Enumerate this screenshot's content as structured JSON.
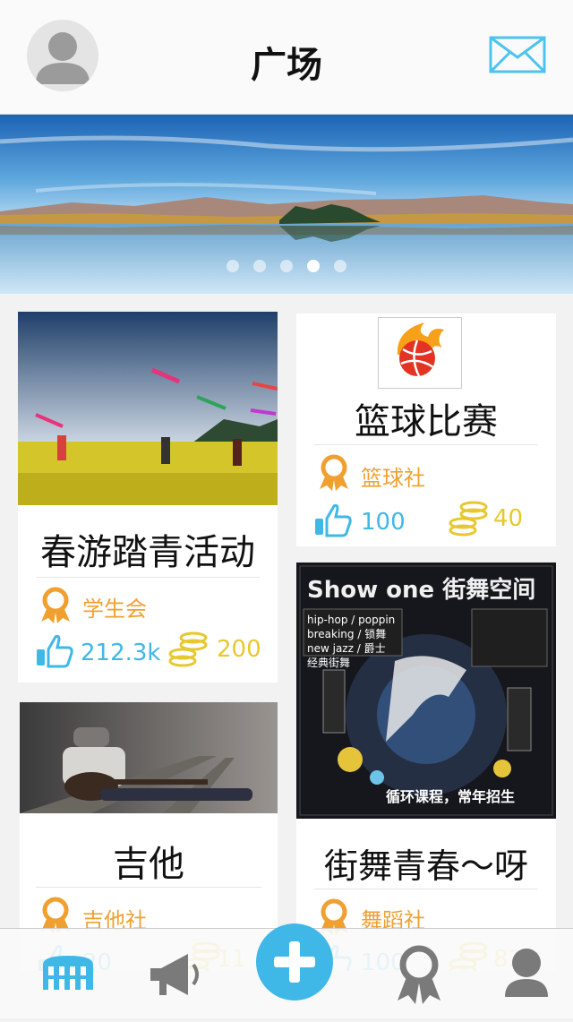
{
  "header": {
    "title": "广场",
    "avatar_icon": "user-avatar-icon",
    "mail_icon": "envelope-icon"
  },
  "banner": {
    "image": "lake-mountain-landscape",
    "slides": 5,
    "active_slide": 4
  },
  "cards": [
    {
      "title": "春游踏青活动",
      "org": "学生会",
      "likes": "212.3k",
      "coins": "200",
      "image": "kite-flying-flower-field"
    },
    {
      "title": "篮球比赛",
      "org": "篮球社",
      "likes": "100",
      "coins": "40",
      "image": "basketball-fire-logo"
    },
    {
      "title": "吉他",
      "org": "吉他社",
      "likes": "20",
      "coins": "11",
      "image": "guitarist-on-railway"
    },
    {
      "title": "街舞青春～呀",
      "org": "舞蹈社",
      "likes": "100",
      "coins": "83",
      "image": "street-dance-poster",
      "poster_text": {
        "headline": "Show one 街舞空间",
        "lines": [
          "hip-hop / poppin",
          "breaking / 锁舞",
          "new jazz / 爵士",
          "经典街舞"
        ],
        "footer": "循环课程，常年招生"
      }
    }
  ],
  "tabbar": {
    "items": [
      "colosseum-icon",
      "megaphone-icon",
      "add-icon",
      "award-icon",
      "profile-icon"
    ],
    "active": "colosseum-icon"
  },
  "colors": {
    "accent_blue": "#3fb8e8",
    "org_orange": "#f0a030",
    "coin_yellow": "#e8c830"
  }
}
